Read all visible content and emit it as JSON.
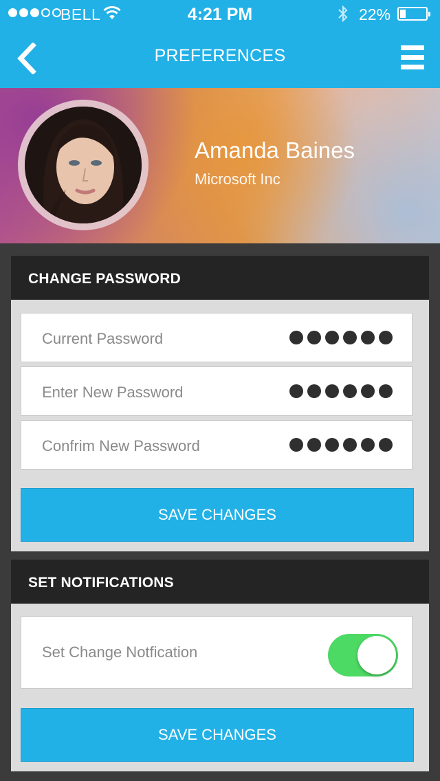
{
  "status_bar": {
    "carrier": "BELL",
    "time": "4:21 PM",
    "battery_percent": "22%",
    "battery_level": 0.22,
    "signal_bars_filled": 3,
    "signal_bars_total": 5,
    "icons": [
      "signal-dots-icon",
      "wifi-icon",
      "bluetooth-icon",
      "battery-icon"
    ]
  },
  "nav": {
    "title": "PREFERENCES",
    "back_icon": "chevron-left-icon",
    "menu_icon": "hamburger-menu-icon"
  },
  "profile": {
    "name": "Amanda Baines",
    "company": "Microsoft Inc"
  },
  "change_password": {
    "heading": "CHANGE PASSWORD",
    "fields": [
      {
        "label": "Current Password",
        "masked_chars": 6
      },
      {
        "label": "Enter New Password",
        "masked_chars": 6
      },
      {
        "label": "Confrim New Password",
        "masked_chars": 6
      }
    ],
    "save_label": "SAVE CHANGES"
  },
  "notifications": {
    "heading": "SET NOTIFICATIONS",
    "toggle_label": "Set Change Notfication",
    "toggle_on": true,
    "save_label": "SAVE CHANGES"
  },
  "colors": {
    "accent": "#22b1e7",
    "header_dark": "#242424",
    "toggle_on": "#4cd964"
  }
}
